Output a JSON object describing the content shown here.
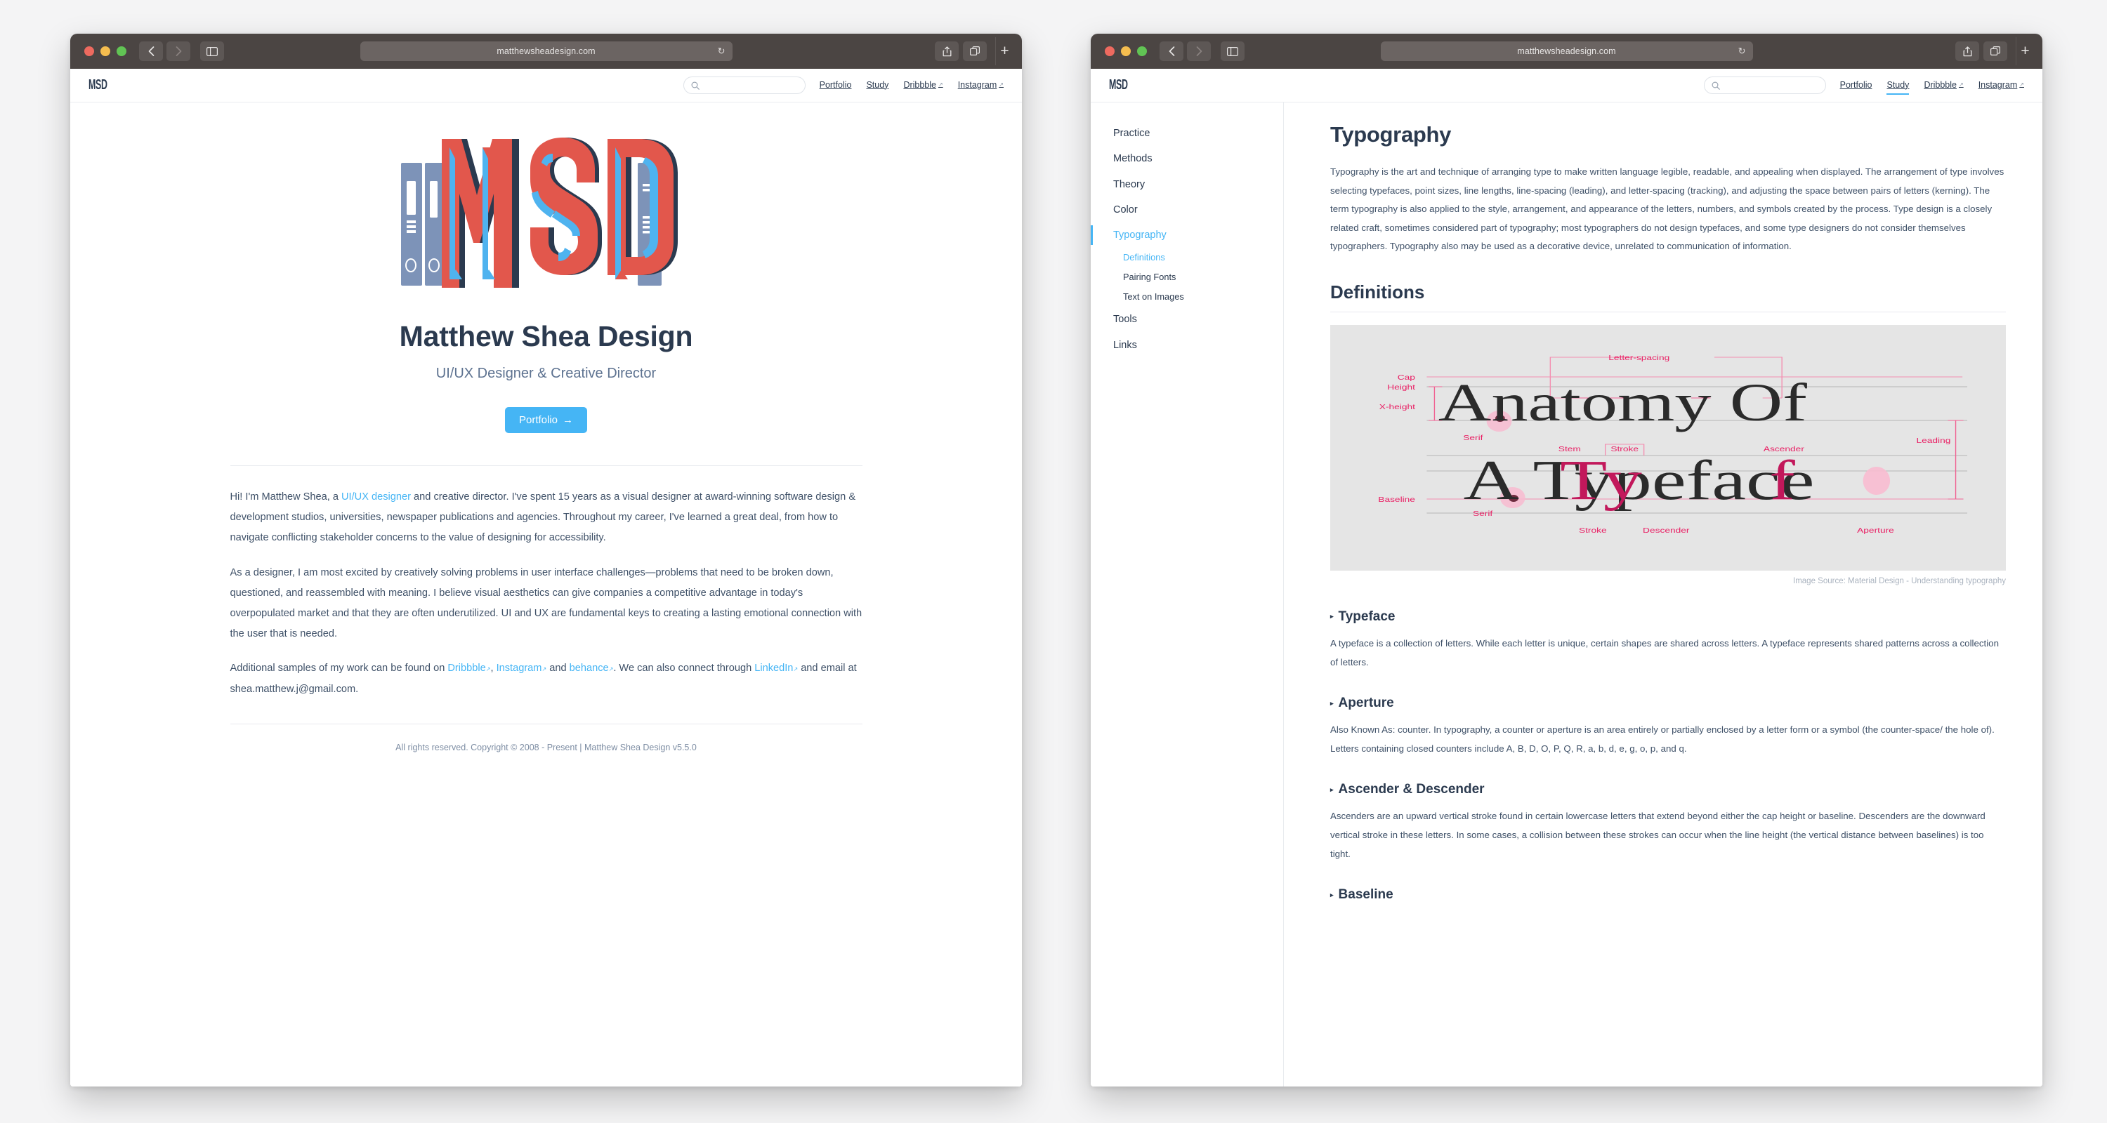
{
  "colors": {
    "accent": "#45b5f5",
    "ink": "#2b3a4f",
    "body_text": "#3f5168",
    "muted": "#7d8da3",
    "titlebar": "#4b4543",
    "logo_red": "#e2574c",
    "logo_blue": "#4fb3ef",
    "logo_navy": "#2b3a4f",
    "logo_binder": "#7d93b8"
  },
  "windows": [
    {
      "id": "left",
      "browser": {
        "url": "matthewsheadesign.com",
        "back_icon": "chevron-left-icon",
        "forward_icon": "chevron-right-icon",
        "sidebar_icon": "sidebar-toggle-icon",
        "reload_icon": "reload-icon",
        "share_icon": "share-icon",
        "tabs_icon": "tab-overview-icon",
        "new_tab_label": "+"
      },
      "header": {
        "logo": "MSD",
        "search_placeholder": "",
        "search_value": "",
        "search_icon": "search-icon",
        "nav": [
          {
            "label": "Portfolio",
            "external": false,
            "active": false
          },
          {
            "label": "Study",
            "external": false,
            "active": false
          },
          {
            "label": "Dribbble",
            "external": true,
            "active": false
          },
          {
            "label": "Instagram",
            "external": true,
            "active": false
          }
        ]
      },
      "hero": {
        "logo_art_alt": "MSD monogram with binders",
        "title": "Matthew Shea Design",
        "subtitle": "UI/UX Designer & Creative Director",
        "cta_label": "Portfolio",
        "cta_arrow": "→"
      },
      "prose": {
        "p1_a": "Hi! I'm Matthew Shea, a ",
        "p1_link": "UI/UX designer",
        "p1_b": " and creative director. I've spent 15 years as a visual designer at award-winning software design & development studios, universities, newspaper publications and agencies. Throughout my career, I've learned a great deal, from how to navigate conflicting stakeholder concerns to the value of designing for accessibility.",
        "p2": "As a designer, I am most excited by creatively solving problems in user interface challenges—problems that need to be broken down, questioned, and reassembled with meaning. I believe visual aesthetics can give companies a competitive advantage in today's overpopulated market and that they are often underutilized. UI and UX are fundamental keys to creating a lasting emotional connection with the user that is needed.",
        "p3_a": "Additional samples of my work can be found on ",
        "p3_link1": "Dribbble",
        "p3_sep1": ", ",
        "p3_link2": "Instagram",
        "p3_sep2": " and ",
        "p3_link3": "behance",
        "p3_b": ". We can also connect through ",
        "p3_link4": "LinkedIn",
        "p3_c": " and email at shea.matthew.j@gmail.com."
      },
      "footer": "All rights reserved. Copyright © 2008 - Present | Matthew Shea Design v5.5.0"
    },
    {
      "id": "right",
      "browser": {
        "url": "matthewsheadesign.com",
        "back_icon": "chevron-left-icon",
        "forward_icon": "chevron-right-icon",
        "sidebar_icon": "sidebar-toggle-icon",
        "reload_icon": "reload-icon",
        "share_icon": "share-icon",
        "tabs_icon": "tab-overview-icon",
        "new_tab_label": "+"
      },
      "header": {
        "logo": "MSD",
        "search_placeholder": "",
        "search_value": "",
        "search_icon": "search-icon",
        "nav": [
          {
            "label": "Portfolio",
            "external": false,
            "active": false
          },
          {
            "label": "Study",
            "external": false,
            "active": true
          },
          {
            "label": "Dribbble",
            "external": true,
            "active": false
          },
          {
            "label": "Instagram",
            "external": true,
            "active": false
          }
        ]
      },
      "sidebar": [
        {
          "label": "Practice",
          "active": false,
          "type": "item"
        },
        {
          "label": "Methods",
          "active": false,
          "type": "item"
        },
        {
          "label": "Theory",
          "active": false,
          "type": "item"
        },
        {
          "label": "Color",
          "active": false,
          "type": "item"
        },
        {
          "label": "Typography",
          "active": true,
          "type": "item"
        },
        {
          "label": "Definitions",
          "active": true,
          "type": "sub"
        },
        {
          "label": "Pairing Fonts",
          "active": false,
          "type": "sub"
        },
        {
          "label": "Text on Images",
          "active": false,
          "type": "sub"
        },
        {
          "label": "Tools",
          "active": false,
          "type": "item"
        },
        {
          "label": "Links",
          "active": false,
          "type": "item"
        }
      ],
      "content": {
        "title": "Typography",
        "intro": "Typography is the art and technique of arranging type to make written language legible, readable, and appealing when displayed. The arrangement of type involves selecting typefaces, point sizes, line lengths, line-spacing (leading), and letter-spacing (tracking), and adjusting the space between pairs of letters (kerning). The term typography is also applied to the style, arrangement, and appearance of the letters, numbers, and symbols created by the process. Type design is a closely related craft, sometimes considered part of typography; most typographers do not design typefaces, and some type designers do not consider themselves typographers. Typography also may be used as a decorative device, unrelated to communication of information.",
        "section_title": "Definitions",
        "figure": {
          "line1": "Anatomy Of",
          "line2": "A Typeface",
          "labels": {
            "letter_spacing": "Letter-spacing",
            "cap": "Cap",
            "height": "Height",
            "x_height": "X-height",
            "serif": "Serif",
            "baseline": "Baseline",
            "stem": "Stem",
            "stroke": "Stroke",
            "ascender": "Ascender",
            "leading": "Leading",
            "descender": "Descender",
            "aperture": "Aperture"
          },
          "caption": "Image Source: Material Design - Understanding typography"
        },
        "definitions": [
          {
            "term": "Typeface",
            "body": "A typeface is a collection of letters. While each letter is unique, certain shapes are shared across letters. A typeface represents shared patterns across a collection of letters."
          },
          {
            "term": "Aperture",
            "body": "Also Known As: counter. In typography, a counter or aperture is an area entirely or partially enclosed by a letter form or a symbol (the counter-space/ the hole of). Letters containing closed counters include A, B, D, O, P, Q, R, a, b, d, e, g, o, p, and q."
          },
          {
            "term": "Ascender & Descender",
            "body": "Ascenders are an upward vertical stroke found in certain lowercase letters that extend beyond either the cap height or baseline. Descenders are the downward vertical stroke in these letters. In some cases, a collision between these strokes can occur when the line height (the vertical distance between baselines) is too tight."
          },
          {
            "term": "Baseline",
            "body": ""
          }
        ]
      }
    }
  ]
}
